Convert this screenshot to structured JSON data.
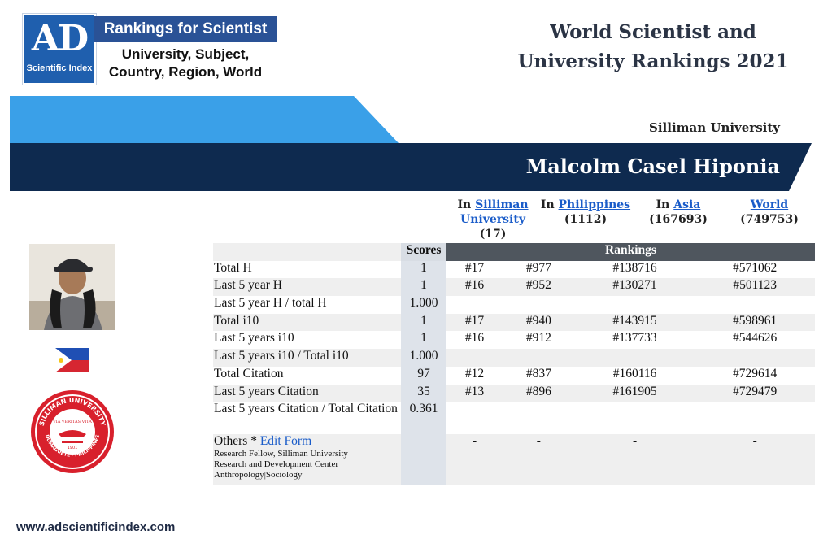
{
  "logo": {
    "mark": "AD",
    "subtitle": "Scientific Index"
  },
  "banner": {
    "title": "Rankings for Scientist",
    "lines": [
      "University, Subject,",
      "Country, Region, World"
    ]
  },
  "page_title": [
    "World Scientist and",
    "University Rankings 2021"
  ],
  "university_label": "Silliman University",
  "scientist_name": "Malcolm Casel Hiponia",
  "columns": [
    {
      "prefix": "In",
      "link": "Silliman University",
      "count": "(17)"
    },
    {
      "prefix": "In",
      "link": "Philippines",
      "count": "(1112)"
    },
    {
      "prefix": "In",
      "link": "Asia",
      "count": "(167693)"
    },
    {
      "prefix": "",
      "link": "World",
      "count": "(749753)"
    }
  ],
  "table": {
    "scores_header": "Scores",
    "rankings_header": "Rankings",
    "rows": [
      {
        "label": "Total H",
        "score": "1",
        "ranks": [
          "#17",
          "#977",
          "#138716",
          "#571062"
        ]
      },
      {
        "label": "Last 5 year H",
        "score": "1",
        "ranks": [
          "#16",
          "#952",
          "#130271",
          "#501123"
        ]
      },
      {
        "label": "Last 5 year H / total H",
        "score": "1.000",
        "ranks": [
          "",
          "",
          "",
          ""
        ]
      },
      {
        "label": "Total i10",
        "score": "1",
        "ranks": [
          "#17",
          "#940",
          "#143915",
          "#598961"
        ]
      },
      {
        "label": "Last 5 years i10",
        "score": "1",
        "ranks": [
          "#16",
          "#912",
          "#137733",
          "#544626"
        ]
      },
      {
        "label": "Last 5 years i10 / Total i10",
        "score": "1.000",
        "ranks": [
          "",
          "",
          "",
          ""
        ]
      },
      {
        "label": "Total Citation",
        "score": "97",
        "ranks": [
          "#12",
          "#837",
          "#160116",
          "#729614"
        ]
      },
      {
        "label": "Last 5 years Citation",
        "score": "35",
        "ranks": [
          "#13",
          "#896",
          "#161905",
          "#729479"
        ]
      },
      {
        "label": "Last 5 years Citation / Total Citation",
        "score": "0.361",
        "ranks": [
          "",
          "",
          "",
          ""
        ]
      }
    ],
    "others": {
      "label": "Others *",
      "link": "Edit Form",
      "detail": [
        "Research Fellow, Silliman University",
        "Research and Development Center",
        "Anthropology|Sociology|"
      ],
      "ranks": [
        "-",
        "-",
        "-",
        "-"
      ]
    }
  },
  "seal_text": {
    "top": "SILLIMAN UNIVERSITY",
    "motto": "VIA VERITAS VITA",
    "year": "1901",
    "bottom": "DUMAGUETE · PHILIPPINES"
  },
  "footer_url": "www.adscientificindex.com",
  "colors": {
    "navy": "#0e2a4f",
    "sky": "#3aa0e8",
    "logo_blue": "#1f5fae",
    "banner_blue": "#2a5296",
    "rankings_head": "#4f565e",
    "link": "#1a5cc9",
    "seal_red": "#d8202c"
  },
  "icons": [
    "avatar-photo",
    "philippines-flag-icon",
    "university-seal-icon"
  ]
}
